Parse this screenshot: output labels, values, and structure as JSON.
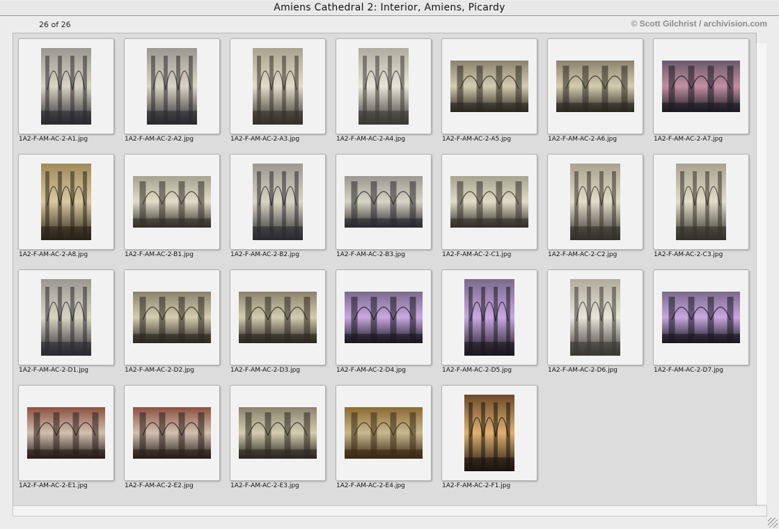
{
  "window": {
    "title": "Amiens Cathedral 2: Interior, Amiens, Picardy"
  },
  "toolbar": {
    "count": "26 of 26",
    "credit": "© Scott Gilchrist / archivision.com"
  },
  "images": [
    {
      "file": "1A2-F-AM-AC-2-A1.jpg",
      "orientation": "portrait",
      "tone": "nave"
    },
    {
      "file": "1A2-F-AM-AC-2-A2.jpg",
      "orientation": "portrait",
      "tone": "nave"
    },
    {
      "file": "1A2-F-AM-AC-2-A3.jpg",
      "orientation": "portrait",
      "tone": "vault"
    },
    {
      "file": "1A2-F-AM-AC-2-A4.jpg",
      "orientation": "portrait",
      "tone": "wall"
    },
    {
      "file": "1A2-F-AM-AC-2-A5.jpg",
      "orientation": "landscape",
      "tone": "arcade"
    },
    {
      "file": "1A2-F-AM-AC-2-A6.jpg",
      "orientation": "landscape",
      "tone": "arcade"
    },
    {
      "file": "1A2-F-AM-AC-2-A7.jpg",
      "orientation": "landscape",
      "tone": "rose"
    },
    {
      "file": "1A2-F-AM-AC-2-A8.jpg",
      "orientation": "portrait",
      "tone": "pulpit"
    },
    {
      "file": "1A2-F-AM-AC-2-B1.jpg",
      "orientation": "landscape",
      "tone": "vault"
    },
    {
      "file": "1A2-F-AM-AC-2-B2.jpg",
      "orientation": "portrait",
      "tone": "nave"
    },
    {
      "file": "1A2-F-AM-AC-2-B3.jpg",
      "orientation": "landscape",
      "tone": "nave"
    },
    {
      "file": "1A2-F-AM-AC-2-C1.jpg",
      "orientation": "landscape",
      "tone": "vault"
    },
    {
      "file": "1A2-F-AM-AC-2-C2.jpg",
      "orientation": "portrait",
      "tone": "vault"
    },
    {
      "file": "1A2-F-AM-AC-2-C3.jpg",
      "orientation": "portrait",
      "tone": "vault"
    },
    {
      "file": "1A2-F-AM-AC-2-D1.jpg",
      "orientation": "portrait",
      "tone": "nave"
    },
    {
      "file": "1A2-F-AM-AC-2-D2.jpg",
      "orientation": "landscape",
      "tone": "arcade"
    },
    {
      "file": "1A2-F-AM-AC-2-D3.jpg",
      "orientation": "landscape",
      "tone": "arcade"
    },
    {
      "file": "1A2-F-AM-AC-2-D4.jpg",
      "orientation": "landscape",
      "tone": "stained"
    },
    {
      "file": "1A2-F-AM-AC-2-D5.jpg",
      "orientation": "portrait",
      "tone": "stained"
    },
    {
      "file": "1A2-F-AM-AC-2-D6.jpg",
      "orientation": "portrait",
      "tone": "wall"
    },
    {
      "file": "1A2-F-AM-AC-2-D7.jpg",
      "orientation": "landscape",
      "tone": "stained"
    },
    {
      "file": "1A2-F-AM-AC-2-E1.jpg",
      "orientation": "landscape",
      "tone": "choir"
    },
    {
      "file": "1A2-F-AM-AC-2-E2.jpg",
      "orientation": "landscape",
      "tone": "choir"
    },
    {
      "file": "1A2-F-AM-AC-2-E3.jpg",
      "orientation": "landscape",
      "tone": "arcade"
    },
    {
      "file": "1A2-F-AM-AC-2-E4.jpg",
      "orientation": "landscape",
      "tone": "carving"
    },
    {
      "file": "1A2-F-AM-AC-2-F1.jpg",
      "orientation": "portrait",
      "tone": "candles"
    }
  ],
  "colors": {
    "nave": [
      "#2a2a2e",
      "#9a9890",
      "#d8d4c4"
    ],
    "vault": [
      "#34302a",
      "#a8a28e",
      "#e0dcc8"
    ],
    "wall": [
      "#3a3834",
      "#b0ab9c",
      "#e8e4d8"
    ],
    "arcade": [
      "#2c2820",
      "#8a826c",
      "#d4ccb0"
    ],
    "rose": [
      "#1c1a22",
      "#6a5a6c",
      "#c090a0"
    ],
    "pulpit": [
      "#2a2218",
      "#a08a5a",
      "#d8c8a0"
    ],
    "stained": [
      "#1a1820",
      "#7a6a8c",
      "#c8a8e0"
    ],
    "choir": [
      "#2a1e1a",
      "#8c5040",
      "#d0c0b0"
    ],
    "carving": [
      "#3a2a14",
      "#8a6a30",
      "#c8b890"
    ],
    "candles": [
      "#1a1410",
      "#6a4a2a",
      "#e0b070"
    ]
  }
}
